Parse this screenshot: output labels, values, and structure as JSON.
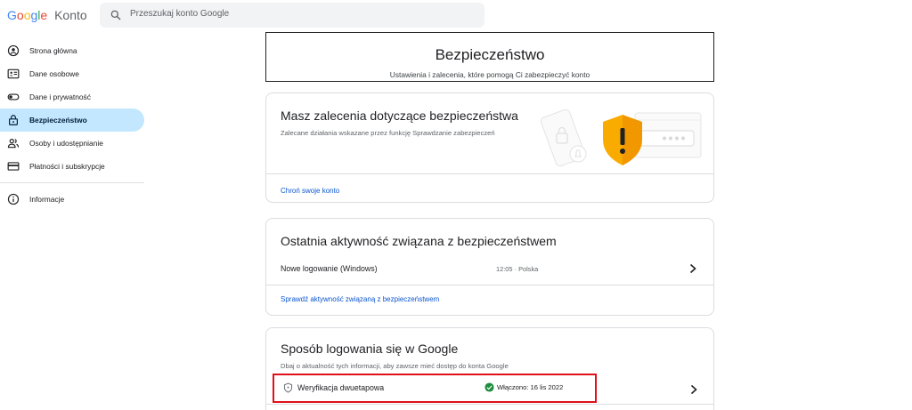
{
  "header": {
    "logo_letters": [
      "G",
      "o",
      "o",
      "g",
      "l",
      "e"
    ],
    "logo_suffix": "Konto",
    "search_placeholder": "Przeszukaj konto Google"
  },
  "sidebar": {
    "items": [
      {
        "label": "Strona główna",
        "icon": "home-icon",
        "active": false
      },
      {
        "label": "Dane osobowe",
        "icon": "id-card-icon",
        "active": false
      },
      {
        "label": "Dane i prywatność",
        "icon": "toggle-icon",
        "active": false
      },
      {
        "label": "Bezpieczeństwo",
        "icon": "lock-icon",
        "active": true
      },
      {
        "label": "Osoby i udostępnianie",
        "icon": "people-icon",
        "active": false
      },
      {
        "label": "Płatności i subskrypcje",
        "icon": "credit-card-icon",
        "active": false
      }
    ],
    "info": {
      "label": "Informacje",
      "icon": "info-icon"
    }
  },
  "page": {
    "title": "Bezpieczeństwo",
    "subtitle": "Ustawienia i zalecenia, które pomogą Ci zabezpieczyć konto"
  },
  "recommendations": {
    "title": "Masz zalecenia dotyczące bezpieczeństwa",
    "description": "Zalecane działania wskazane przez funkcję Sprawdzanie zabezpieczeń",
    "link": "Chroń swoje konto",
    "illustration_icon": "shield-warning-icon"
  },
  "activity": {
    "title": "Ostatnia aktywność związana z bezpieczeństwem",
    "event_label": "Nowe logowanie (Windows)",
    "event_meta": "12:05 · Polska",
    "link": "Sprawdź aktywność związaną z bezpieczeństwem"
  },
  "signin": {
    "title": "Sposób logowania się w Google",
    "description": "Dbaj o aktualność tych informacji, aby zawsze mieć dostęp do konta Google",
    "two_step_label": "Weryfikacja dwuetapowa",
    "two_step_status": "Włączono: 16 lis 2022"
  },
  "colors": {
    "accent_blue": "#0b57d0",
    "active_nav": "#c2e7ff",
    "highlight_red": "#e0101a",
    "status_green": "#1e8e3e",
    "shield_orange": "#f9ab00"
  }
}
